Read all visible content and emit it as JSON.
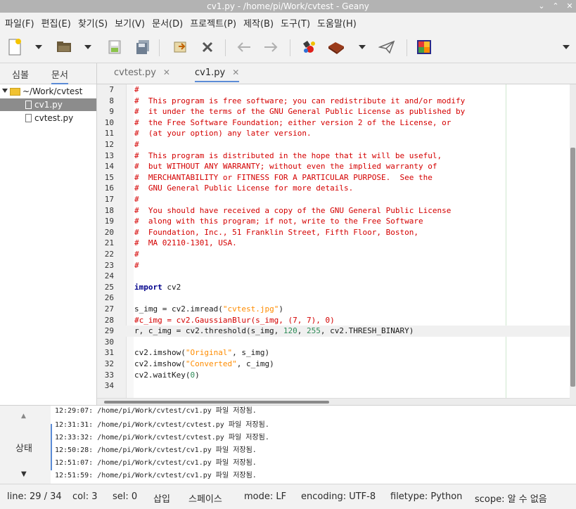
{
  "window": {
    "title": "cv1.py - /home/pi/Work/cvtest - Geany",
    "controls": [
      "⌄",
      "⌃",
      "✕"
    ]
  },
  "menu": [
    "파일(F)",
    "편집(E)",
    "찾기(S)",
    "보기(V)",
    "문서(D)",
    "프로젝트(P)",
    "제작(B)",
    "도구(T)",
    "도움말(H)"
  ],
  "toolbar": {
    "icons": [
      "new-file",
      "open-file",
      "save",
      "save-all",
      "revert",
      "close",
      "back",
      "forward",
      "compile",
      "build",
      "run",
      "color-chooser"
    ]
  },
  "sidebar": {
    "tabs": [
      "심볼",
      "문서"
    ],
    "tree": {
      "folder": "~/Work/cvtest",
      "files": [
        "cv1.py",
        "cvtest.py"
      ],
      "selected": "cv1.py"
    }
  },
  "editor": {
    "tabs": [
      {
        "label": "cvtest.py",
        "close": "✕",
        "active": false
      },
      {
        "label": "cv1.py",
        "close": "✕",
        "active": true
      }
    ],
    "current_line": 29,
    "lines": [
      {
        "n": "7",
        "text": "#"
      },
      {
        "n": "8",
        "text": "#  This program is free software; you can redistribute it and/or modify"
      },
      {
        "n": "9",
        "text": "#  it under the terms of the GNU General Public License as published by"
      },
      {
        "n": "10",
        "text": "#  the Free Software Foundation; either version 2 of the License, or"
      },
      {
        "n": "11",
        "text": "#  (at your option) any later version."
      },
      {
        "n": "12",
        "text": "#"
      },
      {
        "n": "13",
        "text": "#  This program is distributed in the hope that it will be useful,"
      },
      {
        "n": "14",
        "text": "#  but WITHOUT ANY WARRANTY; without even the implied warranty of"
      },
      {
        "n": "15",
        "text": "#  MERCHANTABILITY or FITNESS FOR A PARTICULAR PURPOSE.  See the"
      },
      {
        "n": "16",
        "text": "#  GNU General Public License for more details."
      },
      {
        "n": "17",
        "text": "#"
      },
      {
        "n": "18",
        "text": "#  You should have received a copy of the GNU General Public License"
      },
      {
        "n": "19",
        "text": "#  along with this program; if not, write to the Free Software"
      },
      {
        "n": "20",
        "text": "#  Foundation, Inc., 51 Franklin Street, Fifth Floor, Boston,"
      },
      {
        "n": "21",
        "text": "#  MA 02110-1301, USA."
      },
      {
        "n": "22",
        "text": "#"
      },
      {
        "n": "23",
        "text": "#"
      },
      {
        "n": "24",
        "text": ""
      },
      {
        "n": "25",
        "text": "import cv2"
      },
      {
        "n": "26",
        "text": ""
      },
      {
        "n": "27",
        "text": "s_img = cv2.imread(\"cvtest.jpg\")"
      },
      {
        "n": "28",
        "text": "#c_img = cv2.GaussianBlur(s_img, (7, 7), 0)"
      },
      {
        "n": "29",
        "text": "r, c_img = cv2.threshold(s_img, 120, 255, cv2.THRESH_BINARY)"
      },
      {
        "n": "30",
        "text": ""
      },
      {
        "n": "31",
        "text": "cv2.imshow(\"Original\", s_img)"
      },
      {
        "n": "32",
        "text": "cv2.imshow(\"Converted\", c_img)"
      },
      {
        "n": "33",
        "text": "cv2.waitKey(0)"
      },
      {
        "n": "34",
        "text": ""
      }
    ]
  },
  "messages": {
    "tab_label": "상태",
    "items": [
      "12:29:07: /home/pi/Work/cvtest/cv1.py 파일 저장됨.",
      "12:31:31: /home/pi/Work/cvtest/cvtest.py 파일 저장됨.",
      "12:33:32: /home/pi/Work/cvtest/cvtest.py 파일 저장됨.",
      "12:50:28: /home/pi/Work/cvtest/cv1.py 파일 저장됨.",
      "12:51:07: /home/pi/Work/cvtest/cv1.py 파일 저장됨.",
      "12:51:59: /home/pi/Work/cvtest/cv1.py 파일 저장됨."
    ]
  },
  "status": {
    "line": "line: 29 / 34",
    "col": "col: 3",
    "sel": "sel: 0",
    "insert": "삽입",
    "indent": "스페이스",
    "mode": "mode: LF",
    "encoding": "encoding: UTF-8",
    "filetype": "filetype: Python",
    "scope": "scope: 알 수 없음"
  },
  "colors": {
    "comment": "#d40000",
    "keyword": "#00008b",
    "string": "#ff8c00",
    "number": "#2e8b57",
    "selection": "#8c8c8c",
    "accent": "#5b8bd6"
  }
}
